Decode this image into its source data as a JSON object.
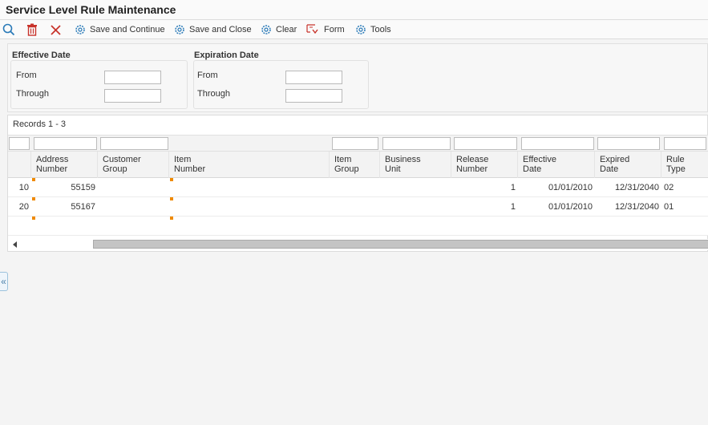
{
  "window": {
    "title": "Service Level Rule Maintenance"
  },
  "toolbar": {
    "save_continue": "Save and Continue",
    "save_close": "Save and Close",
    "clear": "Clear",
    "form": "Form",
    "tools": "Tools"
  },
  "filters": {
    "effective": {
      "title": "Effective Date",
      "from_label": "From",
      "through_label": "Through",
      "from_value": "",
      "through_value": ""
    },
    "expiration": {
      "title": "Expiration Date",
      "from_label": "From",
      "through_label": "Through",
      "from_value": "",
      "through_value": ""
    }
  },
  "grid": {
    "records": "Records 1 - 3",
    "headers": {
      "address_number": "Address\nNumber",
      "customer_group": "Customer\nGroup",
      "item_number": "Item\nNumber",
      "item_group": "Item\nGroup",
      "business_unit": "Business\nUnit",
      "release_number": "Release\nNumber",
      "effective_date": "Effective\nDate",
      "expired_date": "Expired\nDate",
      "rule_type": "Rule\nType"
    },
    "rows": [
      {
        "line": "10",
        "address_number": "55159",
        "customer_group": "",
        "item_number": "",
        "item_group": "",
        "business_unit": "",
        "release_number": "1",
        "effective_date": "01/01/2010",
        "expired_date": "12/31/2040",
        "rule_type": "02"
      },
      {
        "line": "20",
        "address_number": "55167",
        "customer_group": "",
        "item_number": "",
        "item_group": "",
        "business_unit": "",
        "release_number": "1",
        "effective_date": "01/01/2010",
        "expired_date": "12/31/2040",
        "rule_type": "01"
      }
    ]
  },
  "icons": {
    "search": "search-icon",
    "delete": "trash-icon",
    "close": "close-icon",
    "gear": "gear-icon",
    "form": "form-menu-icon",
    "collapse": "double-chevron-left-icon"
  },
  "colors": {
    "accent": "#2a7ab8",
    "delete": "#c8332b",
    "required_marker": "#f08a00"
  }
}
